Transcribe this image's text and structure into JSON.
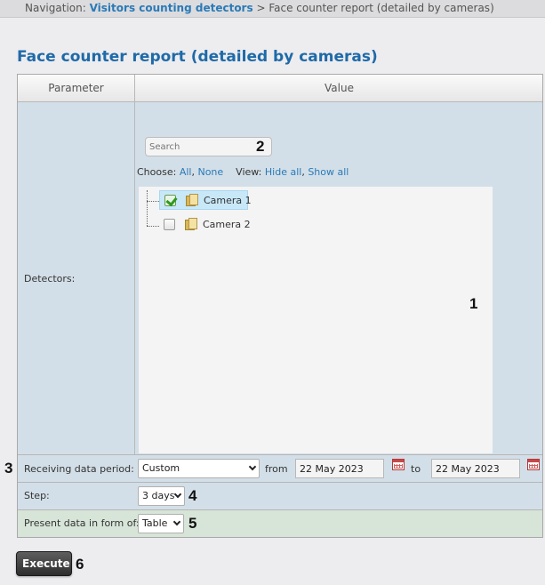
{
  "navigation": {
    "prefix": "Navigation:",
    "link": "Visitors counting detectors",
    "separator": ">",
    "current": "Face counter report (detailed by cameras)"
  },
  "page_title": "Face counter report (detailed by cameras)",
  "table": {
    "header_parameter": "Parameter",
    "header_value": "Value"
  },
  "detectors": {
    "label": "Detectors:",
    "search_placeholder": "Search",
    "choose_label": "Choose:",
    "choose_all": "All",
    "choose_none": "None",
    "view_label": "View:",
    "view_hide_all": "Hide all",
    "view_show_all": "Show all",
    "cameras": [
      {
        "label": "Camera 1",
        "checked": true,
        "selected": true
      },
      {
        "label": "Camera 2",
        "checked": false,
        "selected": false
      }
    ]
  },
  "period": {
    "label": "Receiving data period:",
    "selected": "Custom",
    "from_label": "from",
    "from_value": "22 May 2023",
    "to_label": "to",
    "to_value": "22 May 2023"
  },
  "step": {
    "label": "Step:",
    "selected": "3 days"
  },
  "present": {
    "label": "Present data in form of:",
    "selected": "Table"
  },
  "execute_label": "Execute",
  "callouts": [
    "1",
    "2",
    "3",
    "4",
    "5",
    "6"
  ],
  "colors": {
    "title": "#1f6aa8",
    "link": "#2a7ab8",
    "row_blue": "#d3dfe8",
    "row_green": "#d7e4d8"
  }
}
